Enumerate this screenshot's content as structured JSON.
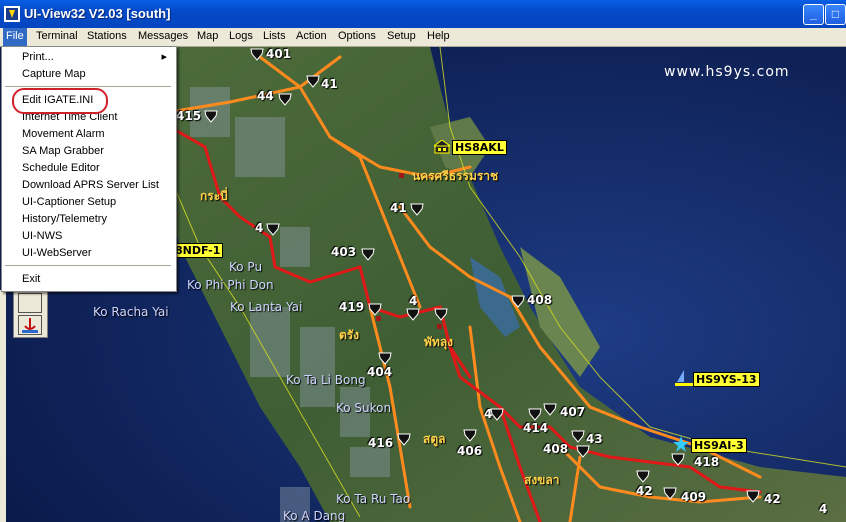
{
  "window": {
    "title": "UI-View32 V2.03 [south]",
    "min_glyph": "_",
    "max_glyph": "□"
  },
  "menubar": [
    "File",
    "Terminal",
    "Stations",
    "Messages",
    "Map",
    "Logs",
    "Lists",
    "Action",
    "Options",
    "Setup",
    "Help"
  ],
  "file_menu": {
    "items": [
      "Print...",
      "Capture Map",
      "Edit IGATE.INI",
      "Internet Time Client",
      "Movement Alarm",
      "SA Map Grabber",
      "Schedule Editor",
      "Download APRS Server List",
      "UI-Captioner Setup",
      "History/Telemetry",
      "UI-NWS",
      "UI-WebServer",
      "Exit"
    ],
    "submenu_arrow": "▸"
  },
  "map": {
    "watermark": "www.hs9ys.com",
    "place_labels": [
      "Ko Pu",
      "Ko Phi Phi Don",
      "Ko Racha Yai",
      "Ko Lanta Yai",
      "Ko Ta Li Bong",
      "Ko Sukon",
      "Ko Ta Ru Tao",
      "Ko A Dang"
    ],
    "thai_labels": [
      "กระบี่",
      "นครศรีธรรมราช",
      "ตรัง",
      "พัทลุง",
      "สตูล",
      "สงขลา"
    ],
    "routes": [
      "401",
      "44",
      "41",
      "415",
      "41",
      "4",
      "403",
      "419",
      "4",
      "408",
      "404",
      "4",
      "407",
      "414",
      "43",
      "416",
      "406",
      "408",
      "418",
      "42",
      "409",
      "42",
      "4"
    ],
    "stations": [
      "HS8AKL",
      "8NDF-1",
      "HS9YS-13",
      "HS9AI-3"
    ]
  },
  "colors": {
    "titlebar": "#0449c8",
    "menu_highlight": "#316ac5",
    "callsign_bg": "#ffff33",
    "highway_red": "#e01818",
    "highway_orange": "#ff8a1e"
  }
}
